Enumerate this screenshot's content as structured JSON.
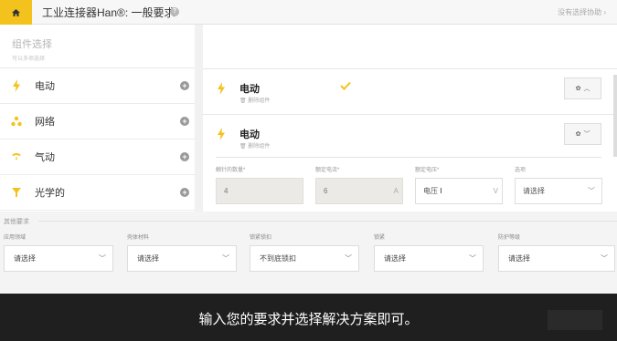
{
  "header": {
    "title": "工业连接器Han®: 一般要求",
    "help_link": "没有选择协助"
  },
  "sidebar": {
    "title": "组件选择",
    "subtitle": "可以多项选择",
    "items": [
      {
        "label": "电动",
        "icon": "bolt-icon"
      },
      {
        "label": "网络",
        "icon": "network-icon"
      },
      {
        "label": "气动",
        "icon": "pneumatic-icon"
      },
      {
        "label": "光学的",
        "icon": "optical-icon"
      }
    ]
  },
  "components": [
    {
      "title": "电动",
      "delete_label": "删除组件"
    },
    {
      "title": "电动",
      "delete_label": "删除组件"
    }
  ],
  "fields": {
    "contacts": {
      "label": "触针的数量*",
      "value": "4"
    },
    "current": {
      "label": "额定电流*",
      "value": "6",
      "unit": "A"
    },
    "voltage": {
      "label": "额定电压*",
      "value": "电压",
      "unit": "V"
    },
    "option": {
      "label": "选项",
      "value": "请选择"
    }
  },
  "other": {
    "title": "其他要求",
    "fields": [
      {
        "label": "应用领域",
        "value": "请选择"
      },
      {
        "label": "壳体材料",
        "value": "请选择"
      },
      {
        "label": "锁紧锁扣",
        "value": "不到底锁扣"
      },
      {
        "label": "锁紧",
        "value": "请选择"
      },
      {
        "label": "防护等级",
        "value": "请选择"
      }
    ]
  },
  "subtitle": "输入您的要求并选择解决方案即可。",
  "colors": {
    "accent": "#f4c21c",
    "subtitle_bg": "#1f1f1f"
  }
}
